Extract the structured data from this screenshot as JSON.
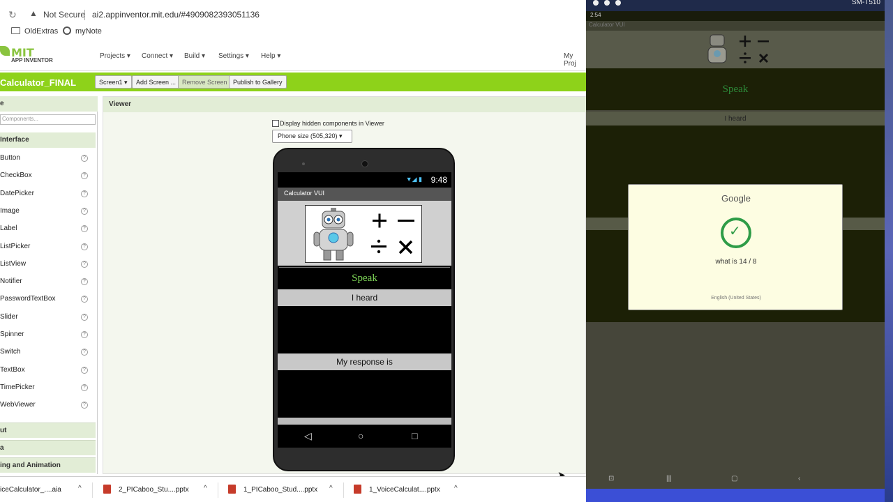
{
  "browser": {
    "security_label": "Not Secure",
    "url": "ai2.appinventor.mit.edu/#4909082393051136",
    "bookmarks": [
      "OldExtras",
      "myNote"
    ]
  },
  "appinventor": {
    "logo_top": "MIT",
    "logo_bottom": "APP INVENTOR",
    "menus": [
      "Projects ▾",
      "Connect ▾",
      "Build ▾",
      "Settings ▾",
      "Help ▾"
    ],
    "my_projects": "My Proj",
    "project_name": "Calculator_FINAL",
    "toolbar": {
      "screen_select": "Screen1 ▾",
      "add_screen": "Add Screen ...",
      "remove_screen": "Remove Screen",
      "publish": "Publish to Gallery"
    }
  },
  "palette": {
    "header": "e",
    "search_placeholder": "Components...",
    "category": "Interface",
    "items": [
      "Button",
      "CheckBox",
      "DatePicker",
      "Image",
      "Label",
      "ListPicker",
      "ListView",
      "Notifier",
      "PasswordTextBox",
      "Slider",
      "Spinner",
      "Switch",
      "TextBox",
      "TimePicker",
      "WebViewer"
    ],
    "help_glyph": "?",
    "sections": [
      "ut",
      "a",
      "ing and Animation"
    ]
  },
  "viewer": {
    "title": "Viewer",
    "hidden_checkbox_label": "Display hidden components in Viewer",
    "phone_size": "Phone size (505,320)  ▾"
  },
  "phone": {
    "time": "9:48",
    "status_icons": "▼◢ ▮",
    "title": "Calculator VUI",
    "speak_button": "Speak",
    "heard_label": "I heard",
    "response_label": "My response is",
    "nav": [
      "◁",
      "○",
      "□"
    ]
  },
  "downloads": [
    {
      "name": "iceCalculator_....aia"
    },
    {
      "name": "2_PICaboo_Stu....pptx"
    },
    {
      "name": "1_PICaboo_Stud....pptx"
    },
    {
      "name": "1_VoiceCalculat....pptx"
    }
  ],
  "emulator": {
    "model": "SM-T510",
    "status_time": "2:54",
    "app_title": "Calculator VUI",
    "speak_button": "Speak",
    "heard_label": "I heard",
    "nav": [
      "⊡",
      "|||",
      "▢",
      "‹"
    ]
  },
  "google_dialog": {
    "title": "Google",
    "query": "what is 14 / 8",
    "language": "English (United States)"
  },
  "colors": {
    "ai_green": "#8ed21a",
    "speak_text": "#7fd858",
    "check_green": "#2e9c47"
  }
}
